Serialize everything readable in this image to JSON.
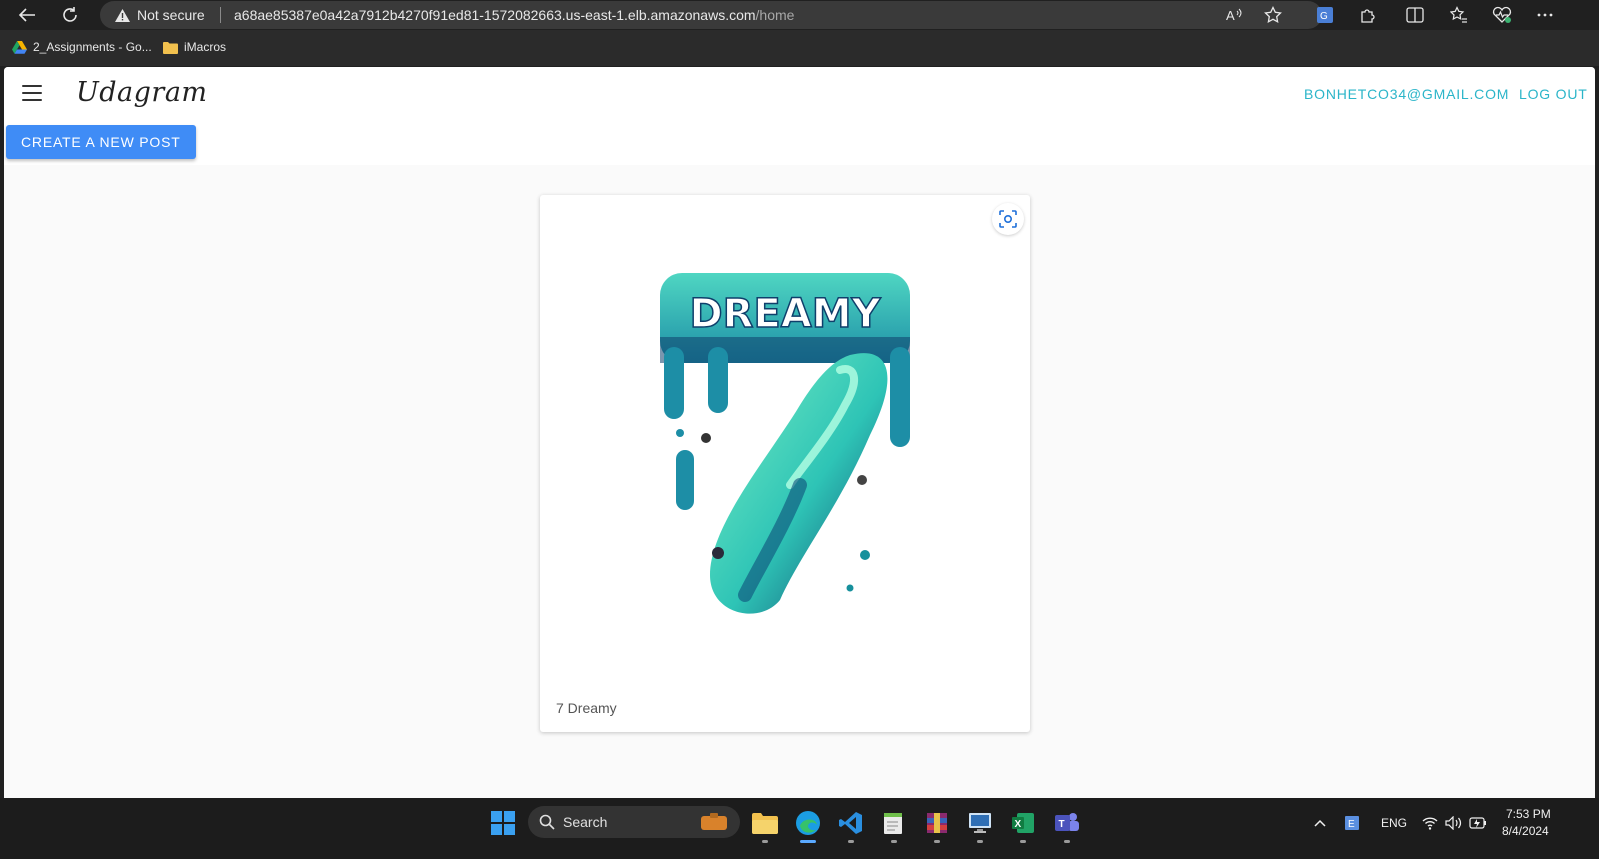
{
  "browser": {
    "security_label": "Not secure",
    "url_host": "a68ae85387e0a42a7912b4270f91ed81-1572082663.us-east-1.elb.amazonaws.com",
    "url_path": "/home",
    "bookmarks": [
      {
        "label": "2_Assignments - Go...",
        "icon": "google-drive-icon"
      },
      {
        "label": "iMacros",
        "icon": "folder-icon"
      }
    ]
  },
  "app": {
    "brand": "Udagram",
    "user_email": "BONHETCO34@GMAIL.COM",
    "logout_label": "LOG OUT",
    "create_post_label": "CREATE A NEW POST"
  },
  "feed": {
    "posts": [
      {
        "caption": "7 Dreamy",
        "image_text": "DREAMY"
      }
    ]
  },
  "taskbar": {
    "search_label": "Search",
    "language": "ENG",
    "time": "7:53 PM",
    "date": "8/4/2024"
  },
  "colors": {
    "accent_link": "#2bb5c9",
    "primary_button": "#3f8cf6"
  }
}
